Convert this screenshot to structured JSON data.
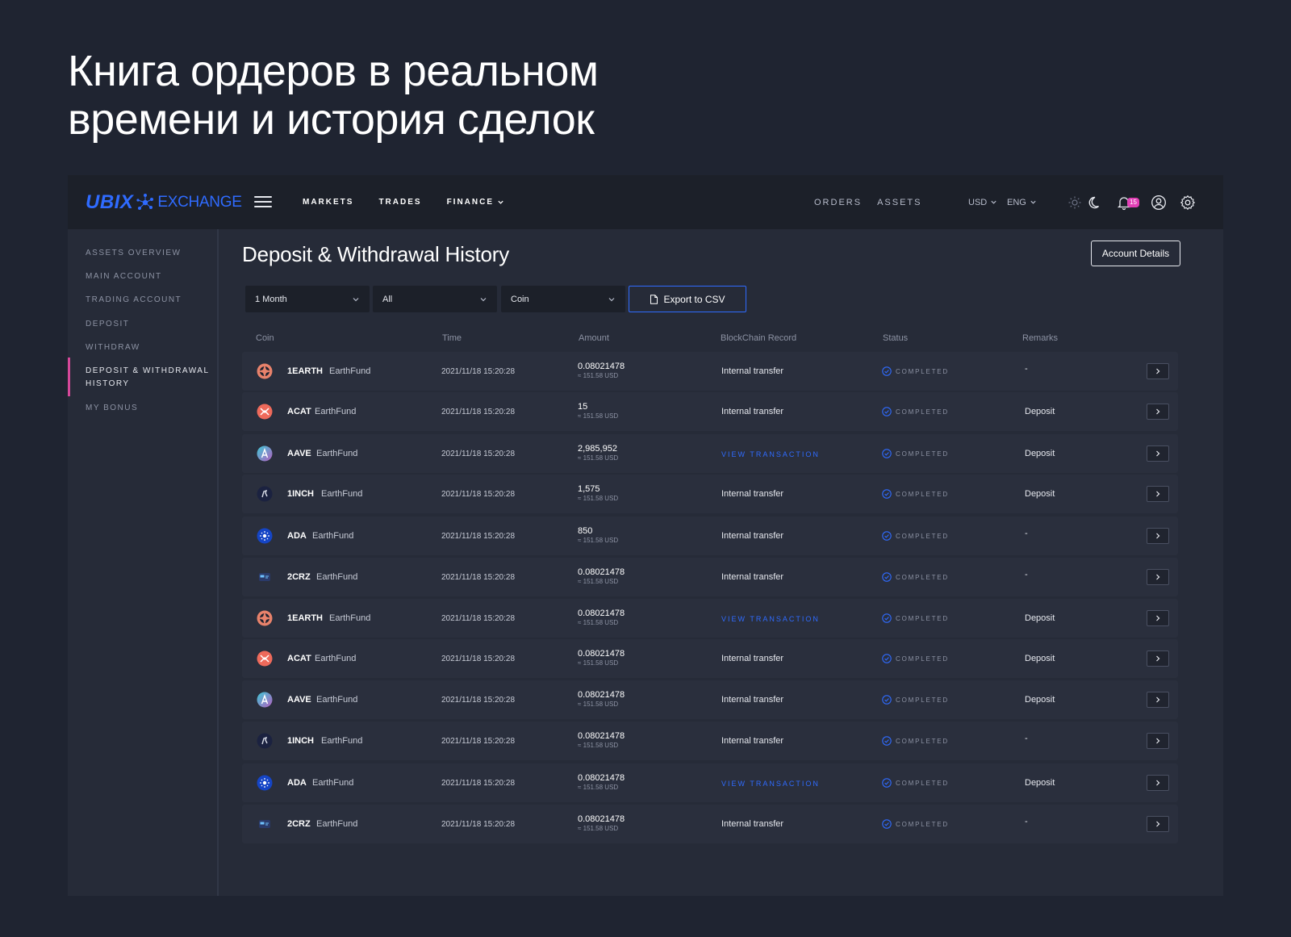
{
  "headline": {
    "line1": "Книга ордеров в реальном",
    "line2": "времени и история сделок"
  },
  "colors": {
    "accent": "#2f6bff",
    "badge": "#e13fb5",
    "active_marker": "#d6489a",
    "background": "#1f2431",
    "panel": "#262b38"
  },
  "logo": {
    "brand": "UBIX",
    "product": "EXCHANGE"
  },
  "nav": {
    "main": [
      {
        "label": "MARKETS"
      },
      {
        "label": "TRADES"
      },
      {
        "label": "FINANCE",
        "icon": "chevron-down-icon"
      }
    ],
    "right": [
      {
        "label": "ORDERS"
      },
      {
        "label": "ASSETS"
      }
    ],
    "currency": "USD",
    "language": "ENG",
    "notifications": "15",
    "icons": [
      "sun-icon",
      "moon-icon",
      "bell-icon",
      "user-icon",
      "gear-icon"
    ]
  },
  "sidebar": {
    "items": [
      {
        "label": "ASSETS OVERVIEW"
      },
      {
        "label": "MAIN ACCOUNT"
      },
      {
        "label": "TRADING ACCOUNT"
      },
      {
        "label": "DEPOSIT"
      },
      {
        "label": "WITHDRAW"
      },
      {
        "label_line1": "DEPOSIT & WITHDRAWAL",
        "label_line2": "HISTORY",
        "active": true
      },
      {
        "label": "MY BONUS"
      }
    ]
  },
  "page": {
    "title": "Deposit & Withdrawal History",
    "account_button": "Account Details",
    "filters": {
      "period": "1 Month",
      "type": "All",
      "coin": "Coin"
    },
    "export_label": "Export to CSV"
  },
  "table": {
    "headers": {
      "coin": "Coin",
      "time": "Time",
      "amount": "Amount",
      "chain": "BlockChain Record",
      "status": "Status",
      "remarks": "Remarks"
    },
    "rows": [
      {
        "symbol": "1EARTH",
        "name": "EarthFund",
        "icon": "earth-coin-icon",
        "time": "2021/11/18 15:20:28",
        "amount": "0.08021478",
        "usd": "≈ 151.58 USD",
        "chain": "Internal transfer",
        "chain_link": false,
        "status": "COMPLETED",
        "remark": "-"
      },
      {
        "symbol": "ACAT",
        "name": "EarthFund",
        "icon": "acat-coin-icon",
        "time": "2021/11/18 15:20:28",
        "amount": "15",
        "usd": "≈ 151.58 USD",
        "chain": "Internal transfer",
        "chain_link": false,
        "status": "COMPLETED",
        "remark": "Deposit"
      },
      {
        "symbol": "AAVE",
        "name": "EarthFund",
        "icon": "aave-coin-icon",
        "time": "2021/11/18 15:20:28",
        "amount": "2,985,952",
        "usd": "≈ 151.58 USD",
        "chain": "VIEW TRANSACTION",
        "chain_link": true,
        "status": "COMPLETED",
        "remark": "Deposit"
      },
      {
        "symbol": "1INCH",
        "name": "EarthFund",
        "icon": "1inch-coin-icon",
        "time": "2021/11/18 15:20:28",
        "amount": "1,575",
        "usd": "≈ 151.58 USD",
        "chain": "Internal transfer",
        "chain_link": false,
        "status": "COMPLETED",
        "remark": "Deposit"
      },
      {
        "symbol": "ADA",
        "name": "EarthFund",
        "icon": "ada-coin-icon",
        "time": "2021/11/18 15:20:28",
        "amount": "850",
        "usd": "≈ 151.58 USD",
        "chain": "Internal transfer",
        "chain_link": false,
        "status": "COMPLETED",
        "remark": "-"
      },
      {
        "symbol": "2CRZ",
        "name": "EarthFund",
        "icon": "2crz-coin-icon",
        "time": "2021/11/18 15:20:28",
        "amount": "0.08021478",
        "usd": "≈ 151.58 USD",
        "chain": "Internal transfer",
        "chain_link": false,
        "status": "COMPLETED",
        "remark": "-"
      },
      {
        "symbol": "1EARTH",
        "name": "EarthFund",
        "icon": "earth-coin-icon",
        "time": "2021/11/18 15:20:28",
        "amount": "0.08021478",
        "usd": "≈ 151.58 USD",
        "chain": "VIEW TRANSACTION",
        "chain_link": true,
        "status": "COMPLETED",
        "remark": "Deposit"
      },
      {
        "symbol": "ACAT",
        "name": "EarthFund",
        "icon": "acat-coin-icon",
        "time": "2021/11/18 15:20:28",
        "amount": "0.08021478",
        "usd": "≈ 151.58 USD",
        "chain": "Internal transfer",
        "chain_link": false,
        "status": "COMPLETED",
        "remark": "Deposit"
      },
      {
        "symbol": "AAVE",
        "name": "EarthFund",
        "icon": "aave-coin-icon",
        "time": "2021/11/18 15:20:28",
        "amount": "0.08021478",
        "usd": "≈ 151.58 USD",
        "chain": "Internal transfer",
        "chain_link": false,
        "status": "COMPLETED",
        "remark": "Deposit"
      },
      {
        "symbol": "1INCH",
        "name": "EarthFund",
        "icon": "1inch-coin-icon",
        "time": "2021/11/18 15:20:28",
        "amount": "0.08021478",
        "usd": "≈ 151.58 USD",
        "chain": "Internal transfer",
        "chain_link": false,
        "status": "COMPLETED",
        "remark": "-"
      },
      {
        "symbol": "ADA",
        "name": "EarthFund",
        "icon": "ada-coin-icon",
        "time": "2021/11/18 15:20:28",
        "amount": "0.08021478",
        "usd": "≈ 151.58 USD",
        "chain": "VIEW TRANSACTION",
        "chain_link": true,
        "status": "COMPLETED",
        "remark": "Deposit"
      },
      {
        "symbol": "2CRZ",
        "name": "EarthFund",
        "icon": "2crz-coin-icon",
        "time": "2021/11/18 15:20:28",
        "amount": "0.08021478",
        "usd": "≈ 151.58 USD",
        "chain": "Internal transfer",
        "chain_link": false,
        "status": "COMPLETED",
        "remark": "-"
      }
    ]
  }
}
